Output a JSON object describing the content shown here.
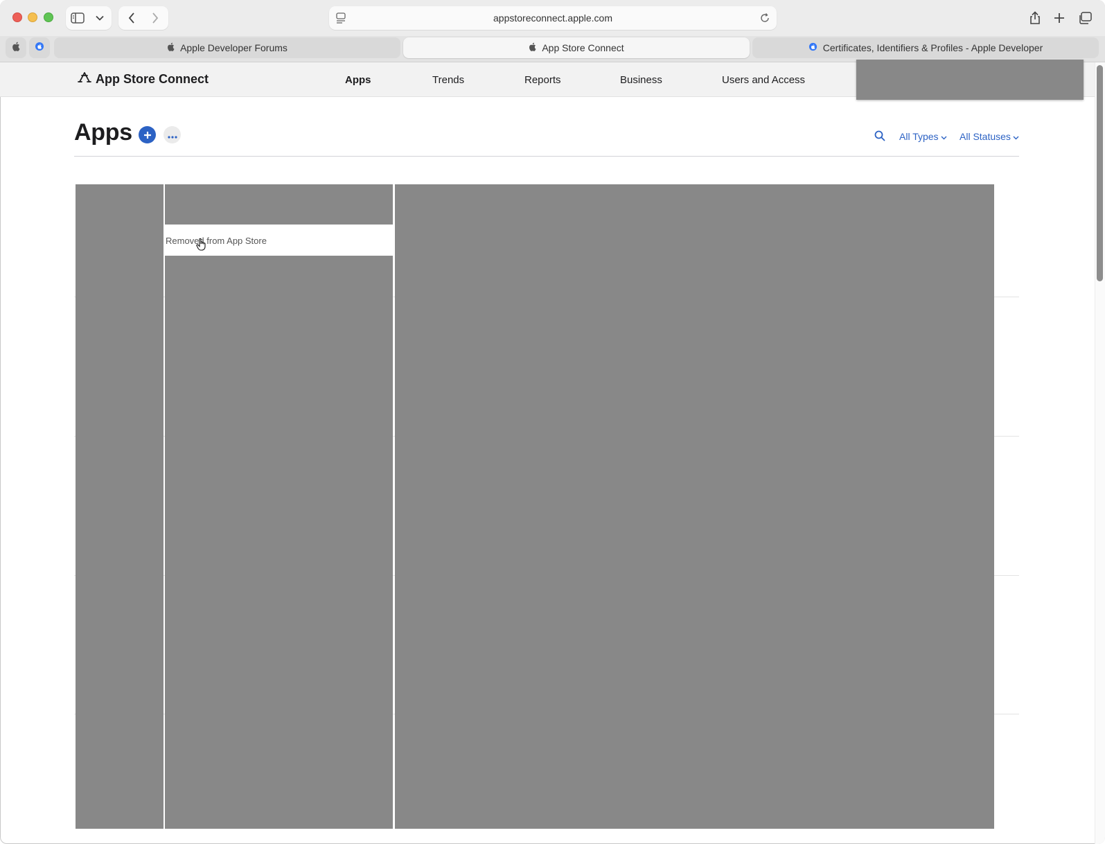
{
  "browser": {
    "address": "appstoreconnect.apple.com",
    "tabs": [
      {
        "label": "Apple Developer Forums"
      },
      {
        "label": "App Store Connect"
      },
      {
        "label": "Certificates, Identifiers & Profiles - Apple Developer"
      }
    ]
  },
  "site": {
    "brand": "App Store Connect",
    "nav": [
      "Apps",
      "Trends",
      "Reports",
      "Business",
      "Users and Access"
    ],
    "current_nav": "Apps"
  },
  "page": {
    "title": "Apps",
    "filters": {
      "types": "All Types",
      "statuses": "All Statuses"
    },
    "status_tooltip": "Removed from App Store"
  },
  "colors": {
    "accent": "#2c62c4",
    "redacted": "#888888"
  }
}
